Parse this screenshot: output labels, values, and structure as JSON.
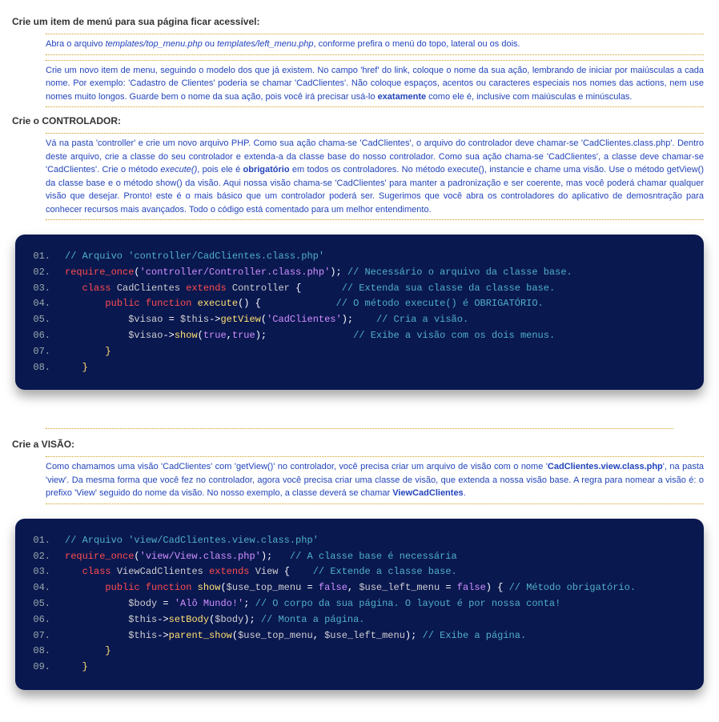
{
  "section1": {
    "heading": "Crie um item de menú para sua página ficar acessível:",
    "para1_pre": "Abra o arquivo ",
    "para1_file1": "templates/top_menu.php",
    "para1_mid": " ou ",
    "para1_file2": "templates/left_menu.php",
    "para1_post": ", conforme prefira o menú do topo, lateral ou os dois.",
    "para2_a": "Crie um novo item de menu, seguindo o modelo dos que já existem. No campo 'href' do link, coloque o nome da sua ação, lembrando de iniciar por maiúsculas a cada nome. Por exemplo: 'Cadastro de Clientes' poderia se chamar 'CadClientes'. Não coloque espaços, acentos ou caracteres especiais nos nomes das actions, nem use nomes muito longos. Guarde bem o nome da sua ação, pois você irá precisar usá-lo ",
    "para2_bold": "exatamente",
    "para2_b": " como ele é, inclusive com maiúsculas e minúsculas."
  },
  "section2": {
    "heading": "Crie o CONTROLADOR:",
    "para_a": "Vá na pasta 'controller' e crie um novo arquivo PHP. Como sua ação chama-se 'CadClientes', o arquivo do controlador deve chamar-se 'CadClientes.class.php'. Dentro deste arquivo, crie a classe do seu controlador e extenda-a da classe base do nosso controlador. Como sua ação chama-se 'CadClientes', a classe deve chamar-se 'CadClientes'. Crie o método ",
    "para_exec": "execute()",
    "para_b": ", pois ele é ",
    "para_bold": "obrigatório",
    "para_c": " em todos os controladores. No método execute(), instancie e chame uma visão. Use o método getView() da classe base e o método show() da visão. Aqui nossa visão chama-se 'CadClientes' para manter a padronização e ser coerente, mas você poderá chamar qualquer visão que desejar. Pronto! este é o mais básico que um controlador poderá ser. Sugerimos que você abra os controladores do aplicativo de demosntração para conhecer recursos mais avançados. Todo o código está comentado para um melhor entendimento."
  },
  "code1": {
    "l01_cmt": "// Arquivo 'controller/CadClientes.class.php'",
    "l02_kw": "require_once",
    "l02_str": "'controller/Controller.class.php'",
    "l02_cmt": "// Necessário o arquivo da classe base.",
    "l03_kw1": "class",
    "l03_name": "CadClientes",
    "l03_kw2": "extends",
    "l03_base": "Controller",
    "l03_cmt": "// Extenda sua classe da classe base.",
    "l04_kw1": "public",
    "l04_kw2": "function",
    "l04_fn": "execute",
    "l04_cmt": "// O método execute() é OBRIGATÓRIO.",
    "l05_var": "$visao",
    "l05_this": "$this",
    "l05_fn": "getView",
    "l05_str": "'CadClientes'",
    "l05_cmt": "// Cria a visão.",
    "l06_var": "$visao",
    "l06_fn": "show",
    "l06_b1": "true",
    "l06_b2": "true",
    "l06_cmt": "// Exibe a visão com os dois menus."
  },
  "section3": {
    "heading": "Crie a VISÃO:",
    "para_a": "Como chamamos uma visão 'CadClientes' com 'getView()' no controlador, você precisa criar um arquivo de visão com o nome '",
    "para_file": "CadClientes.view.class.php",
    "para_b": "', na pasta 'view'. Da mesma forma que você fez no controlador, agora você precisa criar uma classe de visão, que extenda a nossa visão base. A regra para nomear a visão é: o prefixo 'View' seguido do nome da visão. No nosso exemplo, a classe deverá se chamar ",
    "para_link": "ViewCadClientes",
    "para_c": "."
  },
  "code2": {
    "l01_cmt": "// Arquivo 'view/CadClientes.view.class.php'",
    "l02_kw": "require_once",
    "l02_str": "'view/View.class.php'",
    "l02_cmt": "// A classe base é necessária",
    "l03_kw1": "class",
    "l03_name": "ViewCadClientes",
    "l03_kw2": "extends",
    "l03_base": "View",
    "l03_cmt": "// Extende a classe base.",
    "l04_kw1": "public",
    "l04_kw2": "function",
    "l04_fn": "show",
    "l04_p1": "$use_top_menu",
    "l04_d1": "false",
    "l04_p2": "$use_left_menu",
    "l04_d2": "false",
    "l04_cmt": "// Método obrigatório.",
    "l05_var": "$body",
    "l05_str": "'Alô Mundo!'",
    "l05_cmt": "// O corpo da sua página. O layout é por nossa conta!",
    "l06_this": "$this",
    "l06_fn": "setBody",
    "l06_arg": "$body",
    "l06_cmt": "// Monta a página.",
    "l07_this": "$this",
    "l07_fn": "parent_show",
    "l07_a1": "$use_top_menu",
    "l07_a2": "$use_left_menu",
    "l07_cmt": "// Exibe a página."
  },
  "line_numbers": {
    "n01": "01.",
    "n02": "02.",
    "n03": "03.",
    "n04": "04.",
    "n05": "05.",
    "n06": "06.",
    "n07": "07.",
    "n08": "08.",
    "n09": "09."
  }
}
